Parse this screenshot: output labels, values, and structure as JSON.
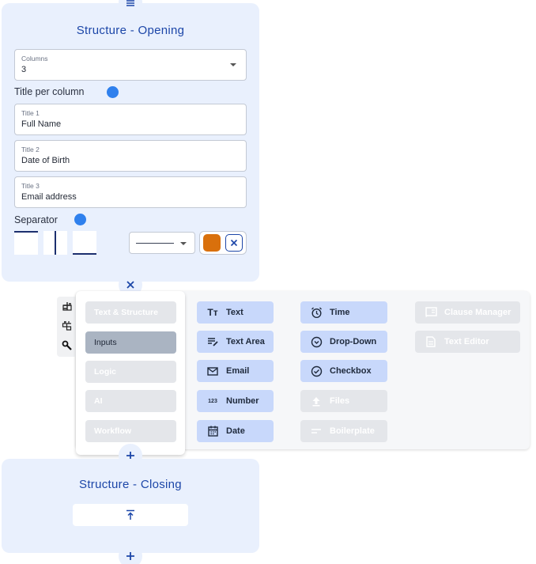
{
  "opening": {
    "title": "Structure - Opening",
    "columns": {
      "label": "Columns",
      "value": "3"
    },
    "title_per_column_label": "Title per column",
    "titles": [
      {
        "label": "Title 1",
        "value": "Full Name"
      },
      {
        "label": "Title 2",
        "value": "Date of Birth"
      },
      {
        "label": "Title 3",
        "value": "Email address"
      }
    ],
    "separator_label": "Separator",
    "separator_color": "#d9700c"
  },
  "palette": {
    "categories": [
      {
        "label": "Text & Structure",
        "active": false
      },
      {
        "label": "Inputs",
        "active": true
      },
      {
        "label": "Logic",
        "active": false
      },
      {
        "label": "AI",
        "active": false
      },
      {
        "label": "Workflow",
        "active": false
      }
    ],
    "tools_col1": [
      {
        "label": "Text",
        "icon": "text-icon"
      },
      {
        "label": "Text Area",
        "icon": "text-area-icon"
      },
      {
        "label": "Email",
        "icon": "email-icon"
      },
      {
        "label": "Number",
        "icon": "number-icon"
      },
      {
        "label": "Date",
        "icon": "calendar-icon"
      }
    ],
    "tools_col2": [
      {
        "label": "Time",
        "icon": "alarm-icon"
      },
      {
        "label": "Drop-Down",
        "icon": "dropdown-icon"
      },
      {
        "label": "Checkbox",
        "icon": "check-circle-icon"
      },
      {
        "label": "Files",
        "icon": "upload-icon",
        "disabled": true
      },
      {
        "label": "Boilerplate",
        "icon": "short-text-icon",
        "disabled": true
      }
    ],
    "tools_col3": [
      {
        "label": "Clause Manager",
        "icon": "clause-icon",
        "disabled": true
      },
      {
        "label": "Text Editor",
        "icon": "document-icon",
        "disabled": true
      }
    ],
    "number_icon_text": "123"
  },
  "closing": {
    "title": "Structure - Closing"
  },
  "colors": {
    "accent": "#1c46a8",
    "panel": "#e9f0fd",
    "toggle": "#2f80ed",
    "tool_active": "#c8d8fb",
    "tool_disabled": "#e4e6ea"
  }
}
